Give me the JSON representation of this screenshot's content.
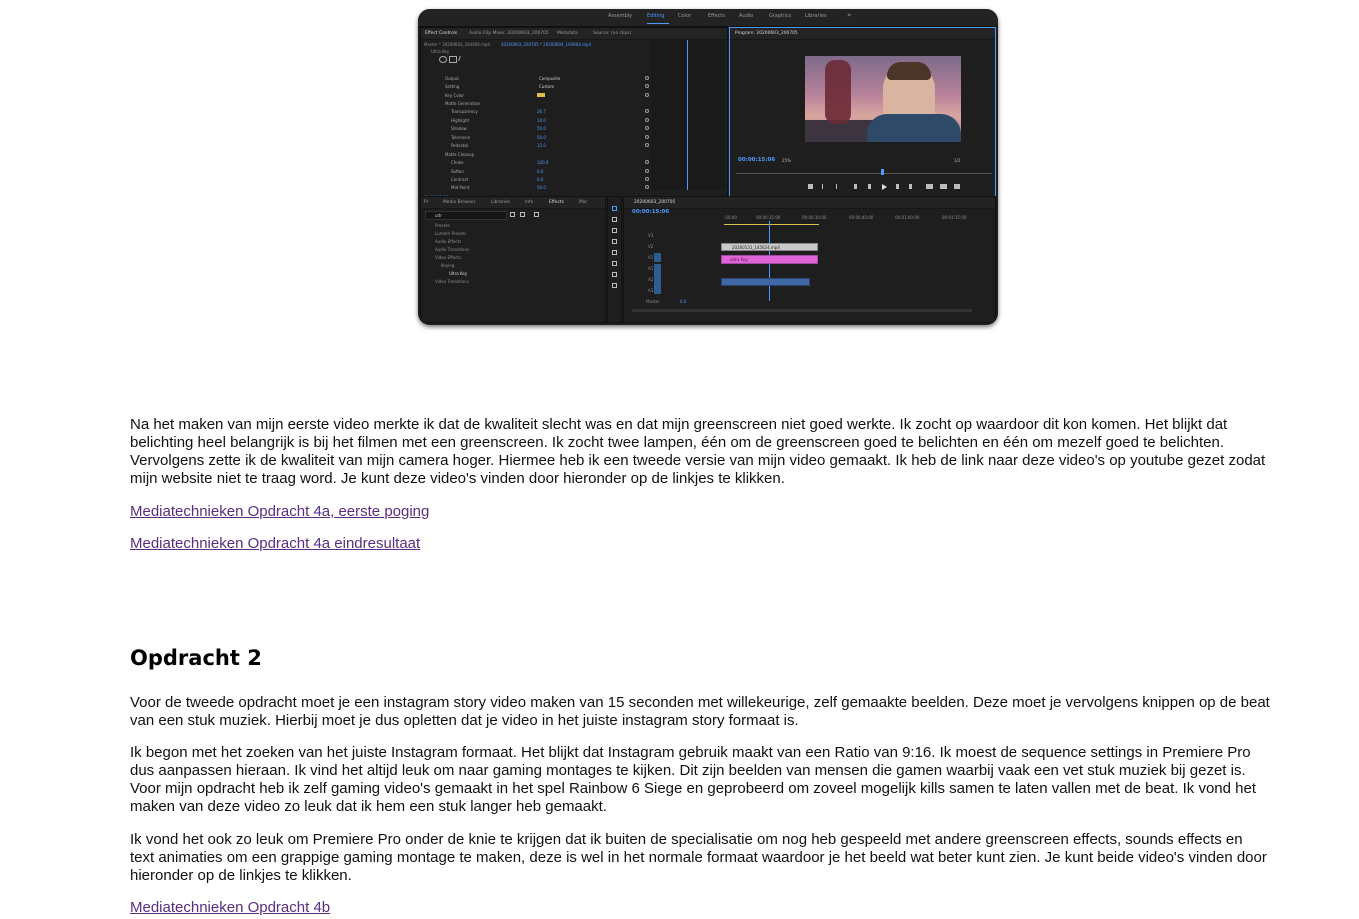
{
  "screenshot": {
    "workspaces": [
      "Assembly",
      "Editing",
      "Color",
      "Effects",
      "Audio",
      "Graphics",
      "Libraries"
    ],
    "active_workspace": "Editing",
    "more_glyph": "»",
    "effect_controls": {
      "tabs": [
        "Effect Controls",
        "Audio Clip Mixer: 20200603_200705",
        "Metadata",
        "Source: (no clips)"
      ],
      "clip_path": "Master * 20200603_164904.mp4",
      "sequence_path": "20200603_200705 * 20200604_164904.mp4",
      "ultra_key": "Ultra Key",
      "rows": [
        {
          "label": "Output",
          "value": "Composite"
        },
        {
          "label": "Setting",
          "value": "Custom"
        },
        {
          "label": "Key Color",
          "value": ""
        },
        {
          "label": "Matte Generation",
          "value": ""
        },
        {
          "label": "Transparency",
          "value": "26.7"
        },
        {
          "label": "Highlight",
          "value": "10.0"
        },
        {
          "label": "Shadow",
          "value": "50.0"
        },
        {
          "label": "Tolerance",
          "value": "50.0"
        },
        {
          "label": "Pedestal",
          "value": "15.0"
        },
        {
          "label": "Matte Cleanup",
          "value": ""
        },
        {
          "label": "Choke",
          "value": "100.0"
        },
        {
          "label": "Soften",
          "value": "0.0"
        },
        {
          "label": "Contrast",
          "value": "0.0"
        },
        {
          "label": "Mid Point",
          "value": "50.0"
        }
      ],
      "footer_timecode": "00:00:15:06"
    },
    "program": {
      "title": "Program: 20200603_200705",
      "timecode": "00:00:15:06",
      "zoom": "25%",
      "quality": "1/2"
    },
    "effects": {
      "tabs": [
        "Pr",
        "Media Browser",
        "Libraries",
        "Info",
        "Effects",
        "Mar"
      ],
      "search": "ultr",
      "tree": [
        "Presets",
        "Lumetri Presets",
        "Audio Effects",
        "Audio Transitions",
        "Video Effects",
        "Keying",
        "Ultra Key",
        "Video Transitions"
      ]
    },
    "timeline": {
      "title": "20200603_200705",
      "timecode": "00:00:15:06",
      "ruler": [
        ":00:00",
        "00:00:15:00",
        "00:00:30:00",
        "00:00:45:00",
        "00:01:00:00",
        "00:01:15:00"
      ],
      "tracks": [
        "V3",
        "V2",
        "V1",
        "A1",
        "A2",
        "A3"
      ],
      "video_clip": "20200531_145624.mp4",
      "pink_clip": "ultra Key",
      "master_label": "Master",
      "master_value": "0.0"
    }
  },
  "article": {
    "intro": "Na het maken van mijn eerste video merkte ik dat de kwaliteit slecht was en dat mijn greenscreen niet goed werkte. Ik zocht op waardoor dit kon komen. Het blijkt dat belichting heel belangrijk is bij het filmen met een greenscreen. Ik zocht twee lampen, één om de greenscreen goed te belichten en één om mezelf goed te belichten. Vervolgens zette ik de kwaliteit van mijn camera hoger. Hiermee heb ik een tweede versie van mijn video gemaakt. Ik heb de link naar deze video's op youtube gezet zodat mijn website niet te traag word. Je kunt deze video's vinden door hieronder op de linkjes te klikken.",
    "link1": "Mediatechnieken Opdracht 4a, eerste poging",
    "link2": "Mediatechnieken Opdracht 4a eindresultaat",
    "heading": "Opdracht 2",
    "para1": "Voor de tweede opdracht moet je een instagram story video maken van 15 seconden met willekeurige, zelf gemaakte beelden. Deze moet je vervolgens knippen op de beat van een stuk muziek. Hierbij moet je dus opletten dat je video in het juiste instagram story formaat is.",
    "para2": "Ik begon met het zoeken van het juiste Instagram formaat. Het blijkt dat Instagram gebruik maakt van een Ratio van 9:16. Ik moest de sequence settings in Premiere Pro dus aanpassen hieraan. Ik vind het altijd leuk om naar gaming montages te kijken. Dit zijn beelden van mensen die gamen waarbij vaak een vet stuk muziek bij gezet is. Voor mijn opdracht heb ik zelf gaming video's gemaakt in het spel Rainbow 6 Siege en geprobeerd om zoveel mogelijk kills samen te laten vallen met de beat. Ik vond het maken van deze video zo leuk dat ik hem een stuk langer heb gemaakt.",
    "para3": "Ik vond het ook zo leuk om Premiere Pro onder de knie te krijgen dat ik buiten de specialisatie om nog heb gespeeld met andere greenscreen effects, sounds effects en text animaties om een grappige gaming montage te maken, deze is wel in het normale formaat waardoor je het beeld wat beter kunt zien. Je kunt beide video's vinden door hieronder op de linkjes te klikken.",
    "link3": "Mediatechnieken Opdracht 4b"
  },
  "colors": {
    "link": "#5a2d82",
    "premiere_blue": "#4e9bff",
    "clip_pink": "#e065d9"
  }
}
